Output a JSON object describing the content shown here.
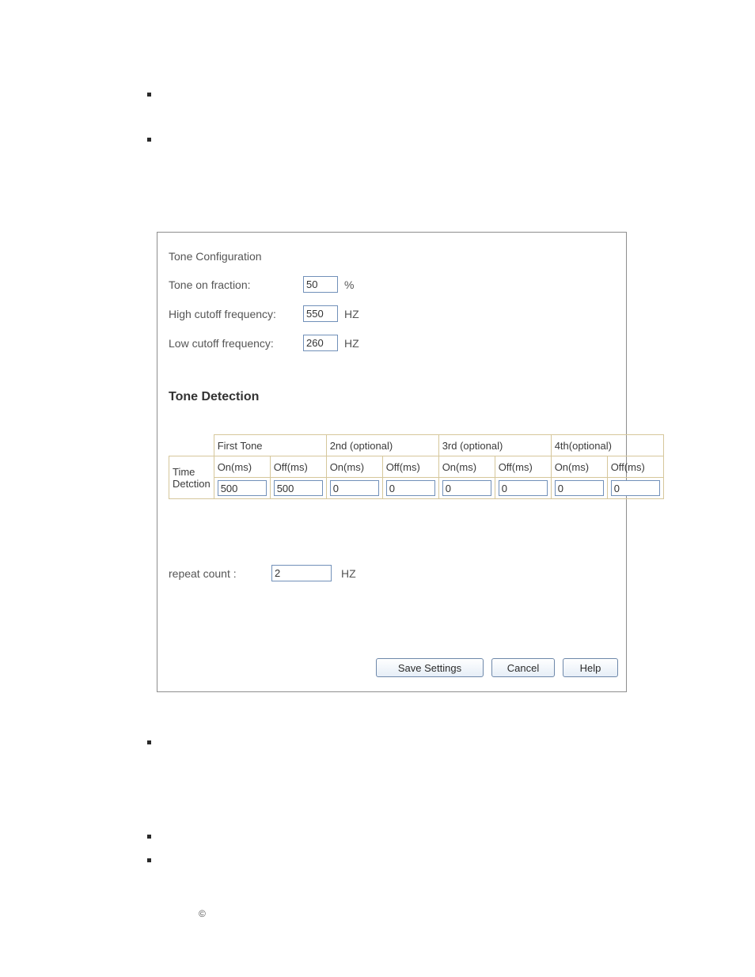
{
  "bullets_y": [
    117,
    174,
    936,
    1055,
    1085
  ],
  "panel": {
    "config_title": "Tone   Configuration",
    "rows": [
      {
        "label": "Tone on fraction:",
        "value": "50",
        "unit": "%"
      },
      {
        "label": "High cutoff frequency:",
        "value": "550",
        "unit": "HZ"
      },
      {
        "label": "Low cutoff frequency:",
        "value": "260",
        "unit": "HZ"
      }
    ],
    "detection_title": "Tone Detection",
    "table": {
      "row_label": "Time Detction",
      "groups": [
        "First Tone",
        "2nd (optional)",
        "3rd (optional)",
        "4th(optional)"
      ],
      "sub": {
        "on": "On(ms)",
        "off": "Off(ms)"
      },
      "values": [
        "500",
        "500",
        "0",
        "0",
        "0",
        "0",
        "0",
        "0"
      ]
    },
    "repeat": {
      "label": "repeat count :",
      "value": "2",
      "unit": "HZ"
    },
    "buttons": {
      "save": "Save Settings",
      "cancel": "Cancel",
      "help": "Help"
    }
  },
  "copyright": "©"
}
